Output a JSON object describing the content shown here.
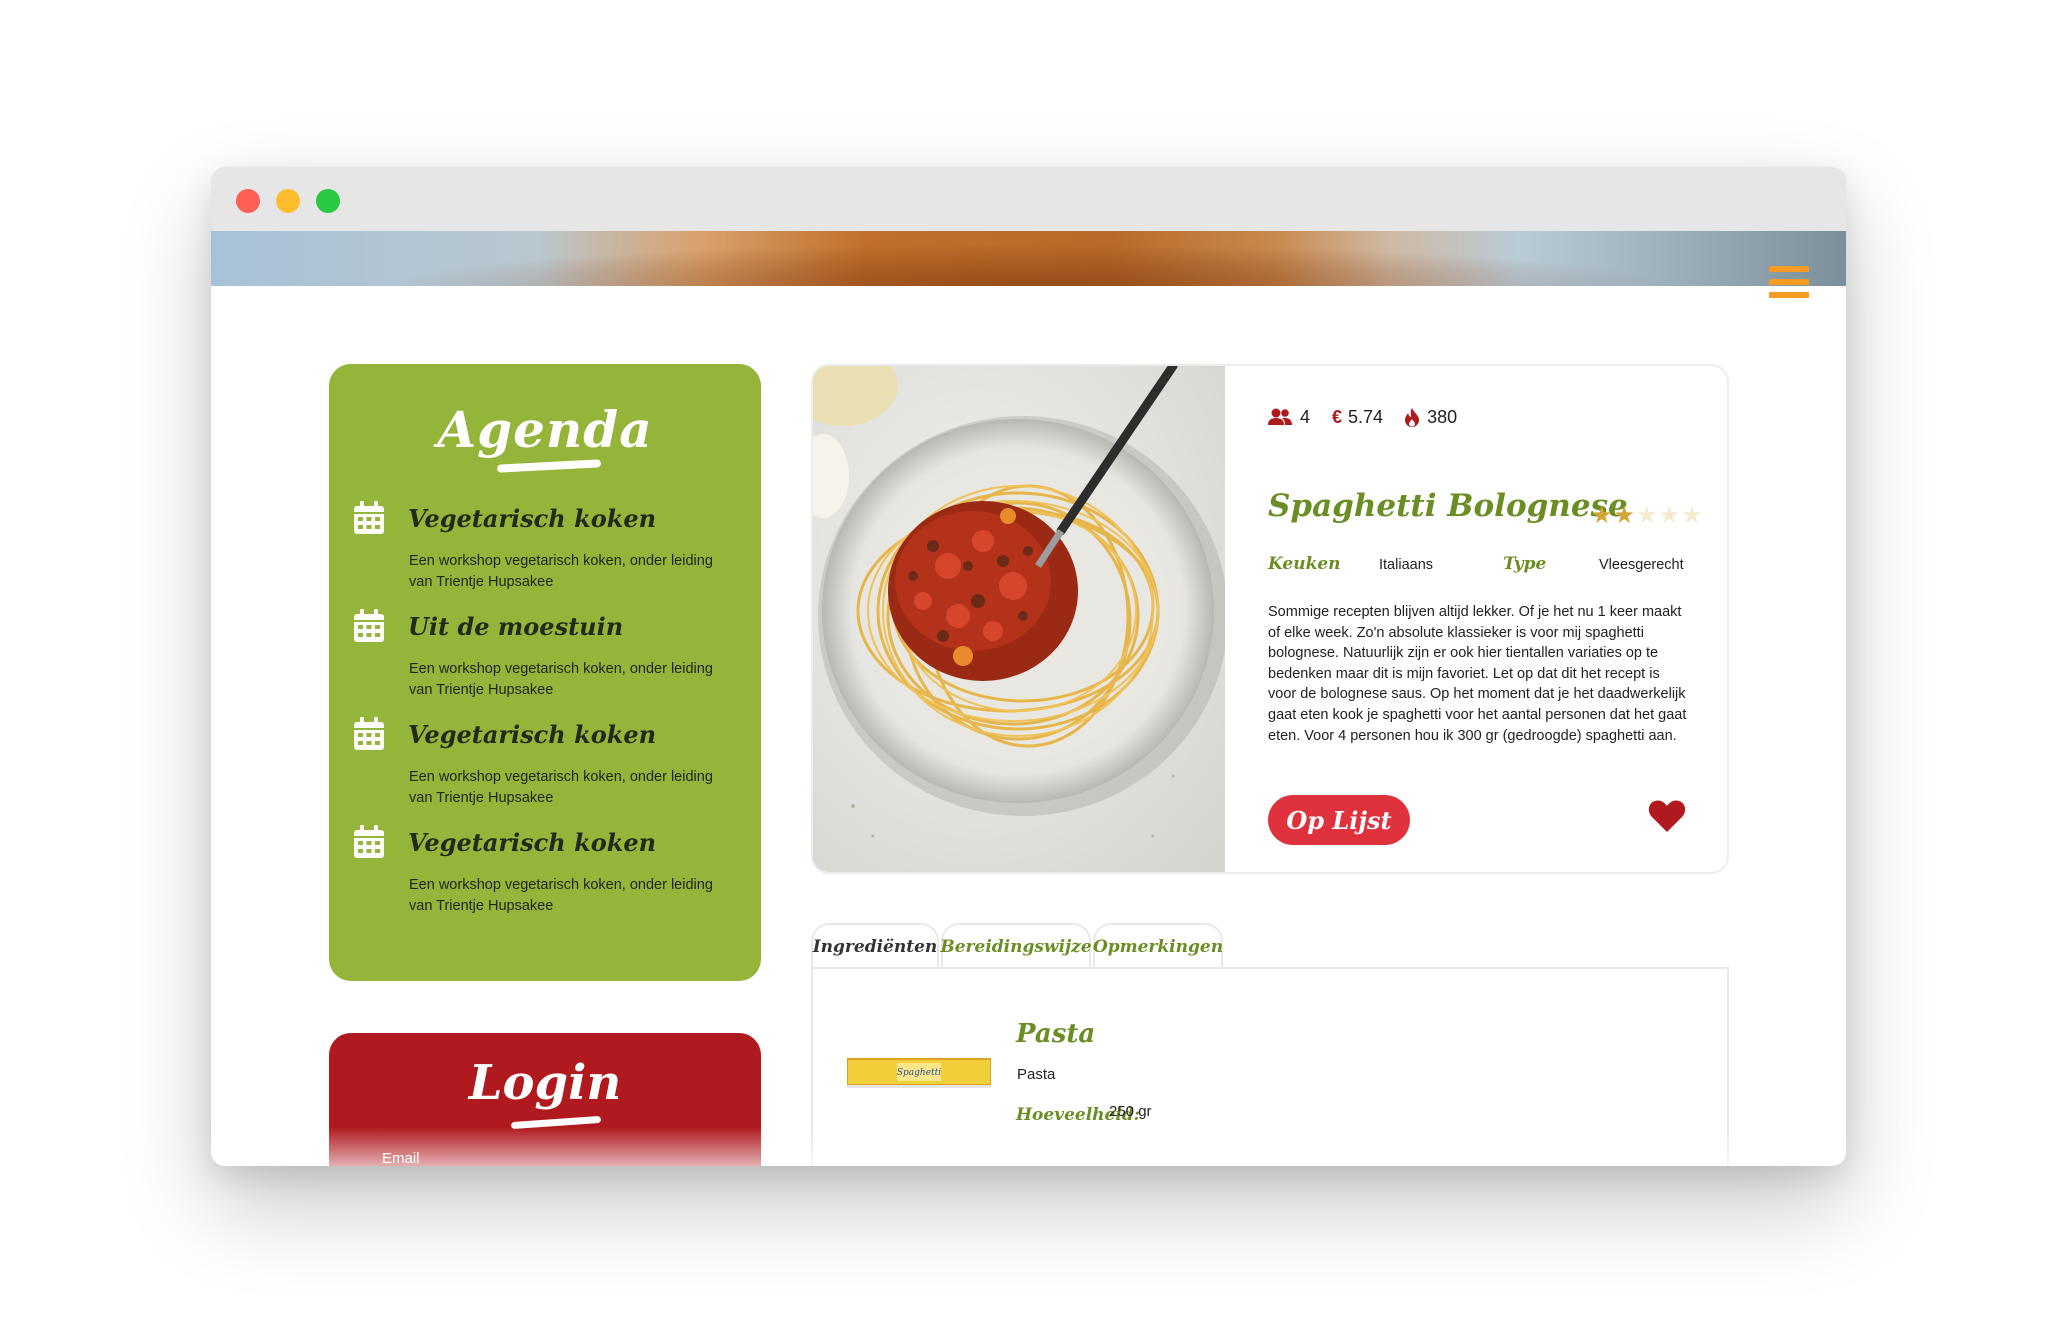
{
  "colors": {
    "agenda_bg": "#95b43a",
    "login_bg": "#b0191e",
    "accent_green": "#6a8e23",
    "button_red": "#e0323c",
    "heart_red": "#b0191e",
    "hamburger": "#f59a22",
    "star_filled": "#d4a437",
    "star_empty": "#f3ecd0"
  },
  "agenda": {
    "title": "Agenda",
    "items": [
      {
        "title": "Vegetarisch koken",
        "description": "Een workshop vegetarisch koken, onder leiding van Trientje Hupsakee",
        "icon": "calendar-icon"
      },
      {
        "title": "Uit de moestuin",
        "description": "Een workshop vegetarisch koken, onder leiding van Trientje Hupsakee",
        "icon": "calendar-icon"
      },
      {
        "title": "Vegetarisch koken",
        "description": "Een workshop vegetarisch koken, onder leiding van Trientje Hupsakee",
        "icon": "calendar-icon"
      },
      {
        "title": "Vegetarisch koken",
        "description": "Een workshop vegetarisch koken, onder leiding van Trientje Hupsakee",
        "icon": "calendar-icon"
      }
    ]
  },
  "login": {
    "title": "Login",
    "email_label": "Email"
  },
  "recipe": {
    "persons": "4",
    "price": "5.74",
    "calories": "380",
    "title": "Spaghetti Bolognese",
    "rating": 2,
    "rating_max": 5,
    "cuisine_label": "Keuken",
    "cuisine_value": "Italiaans",
    "type_label": "Type",
    "type_value": "Vleesgerecht",
    "description": "Sommige recepten blijven altijd lekker. Of je het nu 1 keer maakt of elke week. Zo'n absolute klassieker is voor mij spaghetti bolognese. Natuurlijk zijn er ook hier tientallen variaties op te bedenken maar dit is mijn favoriet. Let op dat dit het recept is voor de bolognese saus. Op het moment dat je het daadwerkelijk gaat eten kook je spaghetti voor het aantal personen dat het gaat eten. Voor 4 personen hou ik 300 gr (gedroogde) spaghetti aan.",
    "button_label": "Op Lijst",
    "favorite_icon": "heart-icon"
  },
  "tabs": [
    {
      "label": "Ingrediënten"
    },
    {
      "label": "Bereidingswijze"
    },
    {
      "label": "Opmerkingen"
    }
  ],
  "ingredient": {
    "name": "Pasta",
    "sub": "Pasta",
    "quantity_label": "Hoeveelheid:",
    "quantity_value": "250 gr",
    "package_text": "Spaghetti"
  }
}
